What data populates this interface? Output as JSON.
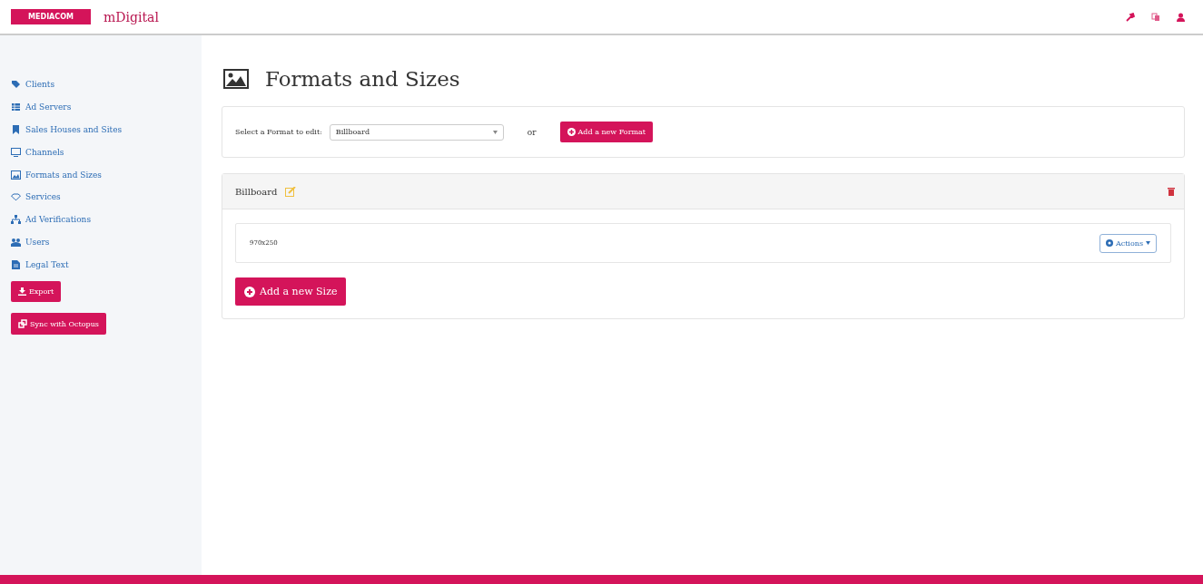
{
  "header": {
    "logo": "MEDIACOM",
    "app_name": "mDigital"
  },
  "sidebar": {
    "items": [
      {
        "label": "Clients"
      },
      {
        "label": "Ad Servers"
      },
      {
        "label": "Sales Houses and Sites"
      },
      {
        "label": "Channels"
      },
      {
        "label": "Formats and Sizes"
      },
      {
        "label": "Services"
      },
      {
        "label": "Ad Verifications"
      },
      {
        "label": "Users"
      },
      {
        "label": "Legal Text"
      }
    ],
    "buttons": [
      {
        "label": "Export"
      },
      {
        "label": "Sync with Octopus"
      }
    ]
  },
  "page_title": "Formats and Sizes",
  "format_select": {
    "label": "Select a Format to edit:",
    "value": "Billboard",
    "or": "or",
    "add_button": "Add a new Format"
  },
  "format_panel": {
    "title": "Billboard",
    "sizes": [
      {
        "name": "970x250",
        "actions": "Actions"
      }
    ],
    "add_size_button": "Add a new Size"
  }
}
